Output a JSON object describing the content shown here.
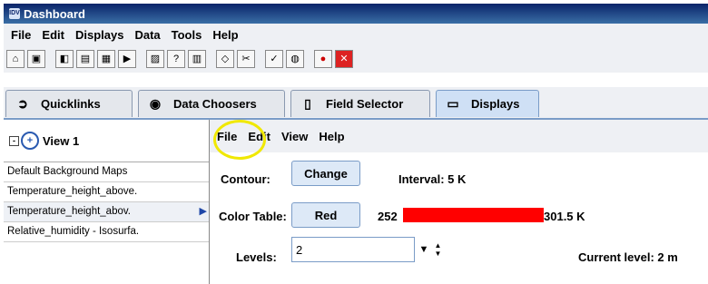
{
  "window": {
    "title": "Dashboard",
    "icon": "idv-app-icon"
  },
  "menubar": [
    "File",
    "Edit",
    "Displays",
    "Data",
    "Tools",
    "Help"
  ],
  "toolbar": {
    "buttons": [
      "home-icon",
      "new-window-icon",
      "save-icon",
      "load-icon",
      "export-icon",
      "bundle-icon",
      "camera-icon",
      "help-icon",
      "console-icon",
      "eraser-icon",
      "cut-icon",
      "edit-icon",
      "globe-icon",
      "stop-icon",
      "close-icon"
    ],
    "glyphs": [
      "⌂",
      "▣",
      "◧",
      "▤",
      "▦",
      "▶",
      "▨",
      "?",
      "▥",
      "◇",
      "✂",
      "✓",
      "◍",
      "●",
      "✕"
    ]
  },
  "tabs": [
    {
      "label": "Quicklinks",
      "glyph": "➲",
      "icon": "quicklinks-icon"
    },
    {
      "label": "Data Choosers",
      "glyph": "◉",
      "icon": "binoculars-icon"
    },
    {
      "label": "Field Selector",
      "glyph": "▯",
      "icon": "clipboard-icon"
    },
    {
      "label": "Displays",
      "glyph": "▭",
      "icon": "monitor-icon"
    }
  ],
  "view": {
    "label": "View 1",
    "collapse": "-",
    "globe": "+"
  },
  "display_list": [
    "Default Background Maps",
    "Temperature_height_above.",
    "Temperature_height_abov.",
    "Relative_humidity - Isosurfa."
  ],
  "selected_arrow": "▶",
  "control_menu": [
    "File",
    "Edit",
    "View",
    "Help"
  ],
  "contour": {
    "label": "Contour:",
    "button": "Change",
    "interval": "Interval: 5 K"
  },
  "color_table": {
    "label": "Color Table:",
    "button": "Red",
    "min": "252",
    "max": "301.5 K",
    "bar_color": "#ff0000"
  },
  "levels": {
    "label": "Levels:",
    "value": "2",
    "current": "Current level: 2 m",
    "dropdown": "▼",
    "spinner": "▲▼"
  },
  "highlight_color": "#f0e800"
}
